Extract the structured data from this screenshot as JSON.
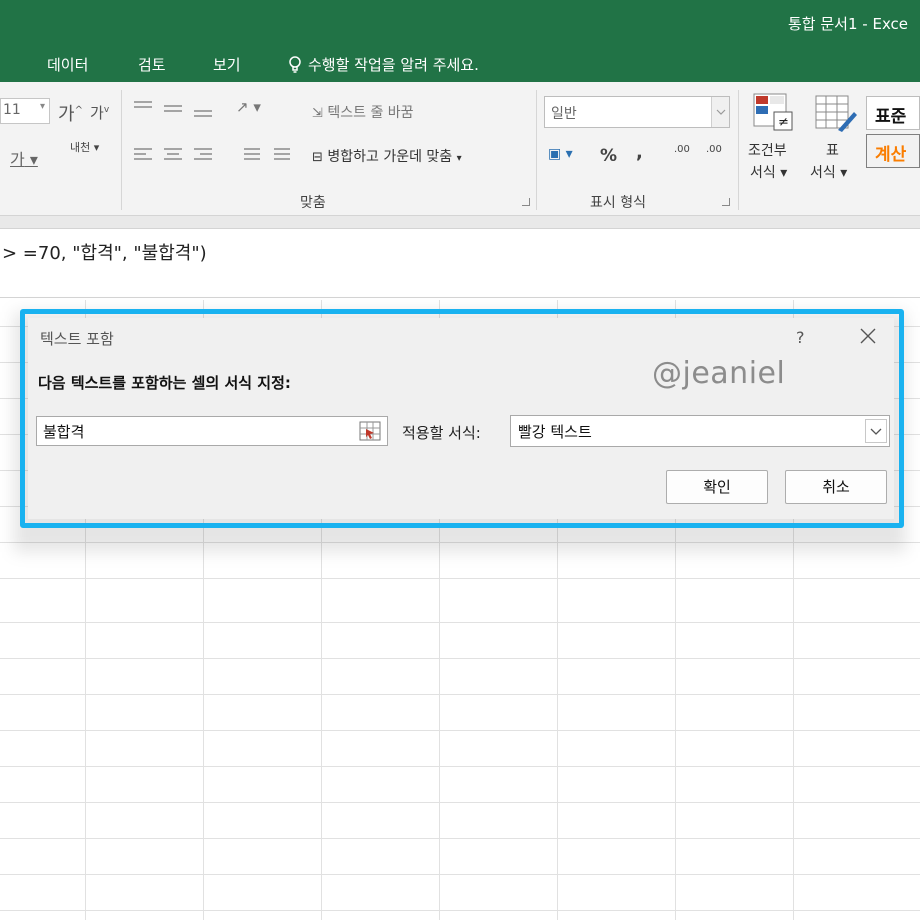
{
  "window": {
    "title": "통합 문서1 - Exce"
  },
  "tabs": [
    "데이터",
    "검토",
    "보기"
  ],
  "tell_me": "수행할 작업을 알려 주세요.",
  "ribbon": {
    "font_size": "11",
    "wrap_text": "텍스트 줄 바꿈",
    "merge_center": "병합하고 가운데 맞춤",
    "alignment_group": "맞춤",
    "number_format": "일반",
    "number_group": "표시 형식",
    "percent": "%",
    "comma": ",",
    "cond_format_line1": "조건부",
    "cond_format_line2": "서식",
    "table_line1": "표",
    "table_line2": "서식",
    "style_normal": "표준",
    "style_calc": "계산",
    "font_grow": "가",
    "font_shrink": "가",
    "phonetic": "내천",
    "underline_glyph": "가",
    "inc_decimal": ".00",
    "dec_decimal": ".00"
  },
  "formula_bar": {
    "text": "> =70, \"합격\", \"불합격\")"
  },
  "dialog": {
    "title": "텍스트 포함",
    "help": "?",
    "prompt": "다음 텍스트를 포함하는 셀의 서식 지정:",
    "input_value": "불합격",
    "apply_label": "적용할 서식:",
    "format_value": "빨강 텍스트",
    "ok": "확인",
    "cancel": "취소",
    "watermark": "@jeaniel"
  },
  "colors": {
    "excel_green": "#217346",
    "highlight": "#19b2f0",
    "calc_text": "#fa7d00"
  }
}
